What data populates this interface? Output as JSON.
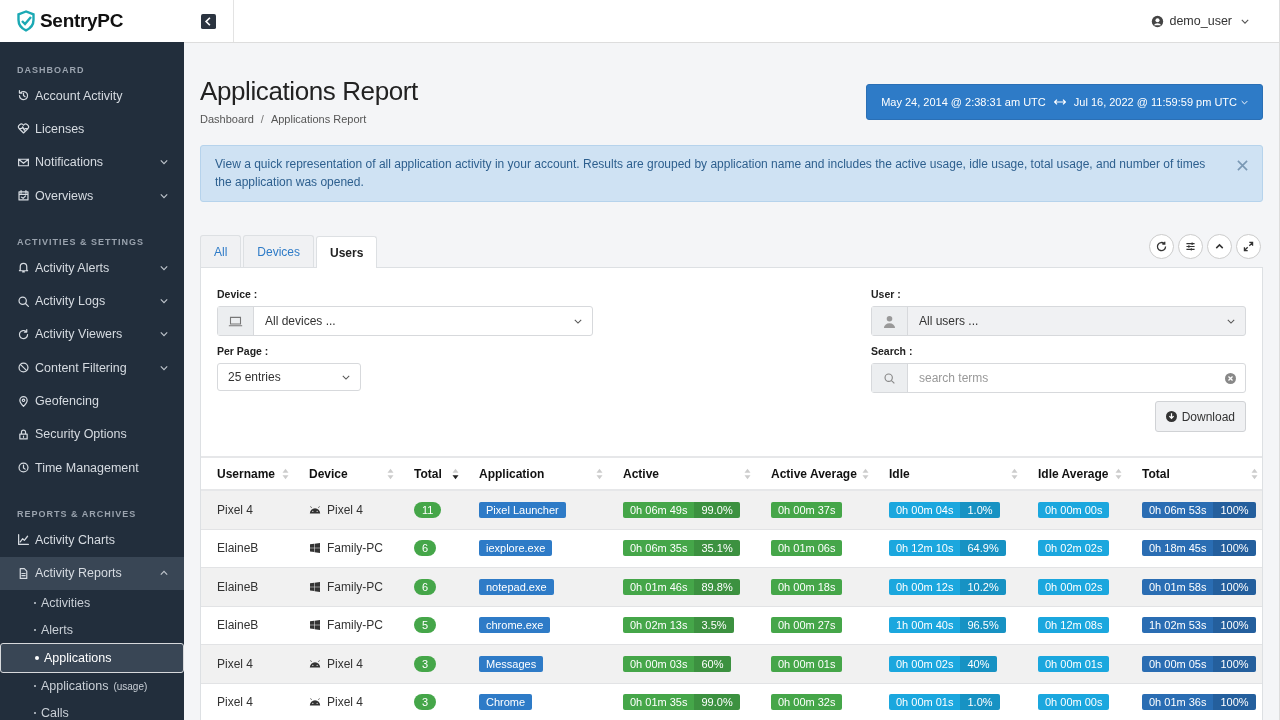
{
  "logo": {
    "name": "SentryPC"
  },
  "sidebar": {
    "sections": [
      {
        "title": "DASHBOARD",
        "items": [
          {
            "label": "Account Activity"
          },
          {
            "label": "Licenses"
          },
          {
            "label": "Notifications",
            "expanded": false
          },
          {
            "label": "Overviews",
            "expanded": false
          }
        ]
      },
      {
        "title": "ACTIVITIES & SETTINGS",
        "items": [
          {
            "label": "Activity Alerts",
            "expanded": false
          },
          {
            "label": "Activity Logs",
            "expanded": false
          },
          {
            "label": "Activity Viewers",
            "expanded": false
          },
          {
            "label": "Content Filtering",
            "expanded": false
          },
          {
            "label": "Geofencing"
          },
          {
            "label": "Security Options"
          },
          {
            "label": "Time Management"
          }
        ]
      },
      {
        "title": "REPORTS & ARCHIVES",
        "items": [
          {
            "label": "Activity Charts"
          },
          {
            "label": "Activity Reports",
            "expanded": true,
            "children": [
              {
                "label": "Activities",
                "selected": false
              },
              {
                "label": "Alerts",
                "selected": false
              },
              {
                "label": "Applications",
                "selected": true
              },
              {
                "label": "Applications",
                "note": "(usage)",
                "selected": false
              },
              {
                "label": "Calls",
                "selected": false
              }
            ]
          }
        ]
      }
    ]
  },
  "topbar": {
    "user": "demo_user"
  },
  "page": {
    "title": "Applications Report",
    "breadcrumb": [
      "Dashboard",
      "Applications Report"
    ],
    "breadcrumb_separator": "/",
    "date_from": "May 24, 2014 @ 2:38:31 am UTC",
    "date_to": "Jul 16, 2022 @ 11:59:59 pm UTC"
  },
  "alert": "View a quick representation of all application activity in your account.  Results are grouped by application name and includes the active usage, idle usage, total usage, and number of times the application was opened.",
  "tabs": [
    {
      "label": "All",
      "selected": false
    },
    {
      "label": "Devices",
      "selected": false
    },
    {
      "label": "Users",
      "selected": true
    }
  ],
  "filters": {
    "device_label": "Device :",
    "device_value": "All devices ...",
    "per_page_label": "Per Page :",
    "per_page_value": "25 entries",
    "user_label": "User :",
    "user_value": "All users ...",
    "search_label": "Search :",
    "search_placeholder": "search terms",
    "download": "Download"
  },
  "table": {
    "columns": [
      {
        "label": "Username",
        "sorted": false
      },
      {
        "label": "Device",
        "sorted": false
      },
      {
        "label": "Total",
        "sorted": true
      },
      {
        "label": "Application",
        "sorted": false
      },
      {
        "label": "Active",
        "sorted": false
      },
      {
        "label": "Active Average",
        "sorted": false
      },
      {
        "label": "Idle",
        "sorted": false
      },
      {
        "label": "Idle Average",
        "sorted": false
      },
      {
        "label": "Total",
        "sorted": false
      }
    ],
    "rows": [
      {
        "username": "Pixel 4",
        "kind": "android",
        "device": "Pixel 4",
        "total": "11",
        "application": "Pixel Launcher",
        "active": "0h 06m 49s",
        "active_pct": "99.0%",
        "active_avg": "0h 00m 37s",
        "idle": "0h 00m 04s",
        "idle_pct": "1.0%",
        "idle_avg": "0h 00m 00s",
        "total_time": "0h 06m 53s",
        "total_pct": "100%"
      },
      {
        "username": "ElaineB",
        "kind": "windows",
        "device": "Family-PC",
        "total": "6",
        "application": "iexplore.exe",
        "active": "0h 06m 35s",
        "active_pct": "35.1%",
        "active_avg": "0h 01m 06s",
        "idle": "0h 12m 10s",
        "idle_pct": "64.9%",
        "idle_avg": "0h 02m 02s",
        "total_time": "0h 18m 45s",
        "total_pct": "100%"
      },
      {
        "username": "ElaineB",
        "kind": "windows",
        "device": "Family-PC",
        "total": "6",
        "application": "notepad.exe",
        "active": "0h 01m 46s",
        "active_pct": "89.8%",
        "active_avg": "0h 00m 18s",
        "idle": "0h 00m 12s",
        "idle_pct": "10.2%",
        "idle_avg": "0h 00m 02s",
        "total_time": "0h 01m 58s",
        "total_pct": "100%"
      },
      {
        "username": "ElaineB",
        "kind": "windows",
        "device": "Family-PC",
        "total": "5",
        "application": "chrome.exe",
        "active": "0h 02m 13s",
        "active_pct": "3.5%",
        "active_avg": "0h 00m 27s",
        "idle": "1h 00m 40s",
        "idle_pct": "96.5%",
        "idle_avg": "0h 12m 08s",
        "total_time": "1h 02m 53s",
        "total_pct": "100%"
      },
      {
        "username": "Pixel 4",
        "kind": "android",
        "device": "Pixel 4",
        "total": "3",
        "application": "Messages",
        "active": "0h 00m 03s",
        "active_pct": "60%",
        "active_avg": "0h 00m 01s",
        "idle": "0h 00m 02s",
        "idle_pct": "40%",
        "idle_avg": "0h 00m 01s",
        "total_time": "0h 00m 05s",
        "total_pct": "100%"
      },
      {
        "username": "Pixel 4",
        "kind": "android",
        "device": "Pixel 4",
        "total": "3",
        "application": "Chrome",
        "active": "0h 01m 35s",
        "active_pct": "99.0%",
        "active_avg": "0h 00m 32s",
        "idle": "0h 00m 01s",
        "idle_pct": "1.0%",
        "idle_avg": "0h 00m 00s",
        "total_time": "0h 01m 36s",
        "total_pct": "100%"
      }
    ]
  }
}
